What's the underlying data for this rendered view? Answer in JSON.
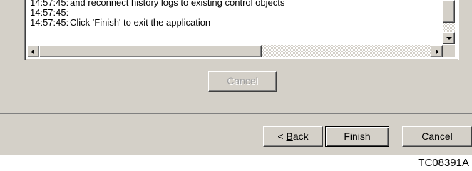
{
  "log": {
    "lines": [
      {
        "time": "14:57:45:",
        "text": "and reconnect history logs to existing control objects"
      },
      {
        "time": "14:57:45:",
        "text": ""
      },
      {
        "time": "14:57:45:",
        "text": "Click 'Finish' to exit the application"
      }
    ]
  },
  "progress_panel": {
    "cancel_label": "Cancel"
  },
  "wizard_buttons": {
    "back_prefix": "< ",
    "back_mnemonic": "B",
    "back_rest": "ack",
    "finish_label": "Finish",
    "cancel_label": "Cancel"
  },
  "figure_code": "TC08391A"
}
